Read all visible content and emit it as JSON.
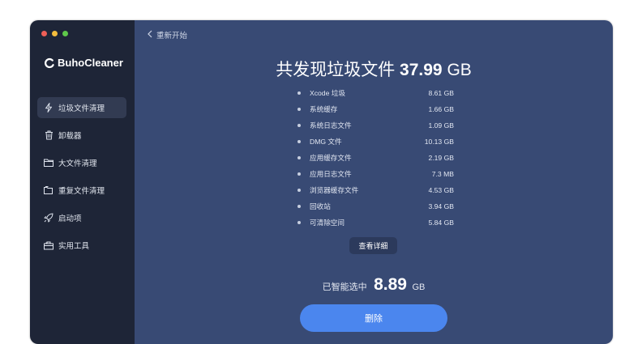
{
  "app": {
    "name": "BuhoCleaner"
  },
  "sidebar": {
    "items": [
      {
        "label": "垃圾文件清理",
        "icon": "bolt-icon",
        "active": true
      },
      {
        "label": "卸载器",
        "icon": "trash-icon",
        "active": false
      },
      {
        "label": "大文件清理",
        "icon": "folder-icon",
        "active": false
      },
      {
        "label": "重复文件清理",
        "icon": "duplicate-folder-icon",
        "active": false
      },
      {
        "label": "启动项",
        "icon": "rocket-icon",
        "active": false
      },
      {
        "label": "实用工具",
        "icon": "toolbox-icon",
        "active": false
      }
    ]
  },
  "header": {
    "back_label": "重新开始"
  },
  "summary": {
    "title_prefix": "共发现垃圾文件",
    "total_value": "37.99",
    "total_unit": "GB"
  },
  "items": [
    {
      "name": "Xcode 垃圾",
      "size": "8.61 GB"
    },
    {
      "name": "系统缓存",
      "size": "1.66 GB"
    },
    {
      "name": "系统日志文件",
      "size": "1.09 GB"
    },
    {
      "name": "DMG 文件",
      "size": "10.13 GB"
    },
    {
      "name": "应用缓存文件",
      "size": "2.19 GB"
    },
    {
      "name": "应用日志文件",
      "size": "7.3 MB"
    },
    {
      "name": "浏览器缓存文件",
      "size": "4.53 GB"
    },
    {
      "name": "回收站",
      "size": "3.94 GB"
    },
    {
      "name": "可清除空间",
      "size": "5.84 GB"
    }
  ],
  "details_button": "查看详细",
  "selection": {
    "label": "已智能选中",
    "value": "8.89",
    "unit": "GB"
  },
  "delete_button": "删除",
  "colors": {
    "sidebar_bg": "#1e2537",
    "main_bg": "#384a74",
    "accent": "#4b86ee"
  }
}
